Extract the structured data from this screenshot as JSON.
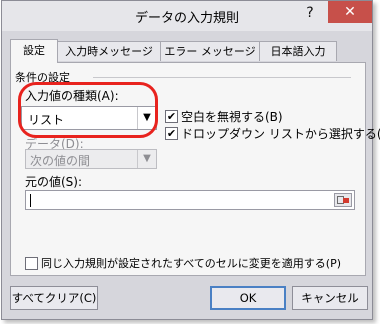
{
  "window": {
    "title": "データの入力規則",
    "help_label": "?",
    "close_label": "✕"
  },
  "tabs": [
    {
      "label": "設定",
      "active": true
    },
    {
      "label": "入力時メッセージ",
      "active": false
    },
    {
      "label": "エラー メッセージ",
      "active": false
    },
    {
      "label": "日本語入力",
      "active": false
    }
  ],
  "settings": {
    "group_label": "条件の設定",
    "allow_label": "入力値の種類(A):",
    "allow_value": "リスト",
    "data_label": "データ(D):",
    "data_value": "次の値の間",
    "ignore_blank_label": "空白を無視する(B)",
    "ignore_blank_checked": true,
    "dropdown_label": "ドロップダウン リストから選択する(I)",
    "dropdown_checked": true,
    "source_label": "元の値(S):",
    "source_value": "",
    "apply_all_label": "同じ入力規則が設定されたすべてのセルに変更を適用する(P)",
    "apply_all_checked": false
  },
  "buttons": {
    "clear_all": "すべてクリア(C)",
    "ok": "OK",
    "cancel": "キャンセル"
  },
  "icons": {
    "dropdown": "chevron-down-icon",
    "range_select": "range-select-icon",
    "check": "✔"
  },
  "colors": {
    "highlight": "#e8231e",
    "close": "#c7504a",
    "focus": "#4a80c4"
  }
}
